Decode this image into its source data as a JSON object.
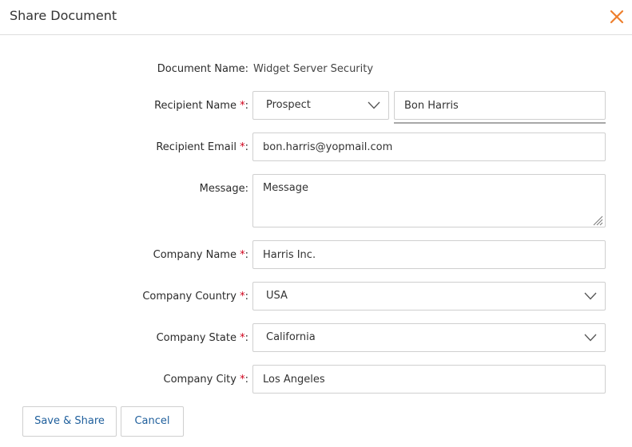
{
  "dialog": {
    "title": "Share Document",
    "close_icon": "close-icon",
    "accent_color": "#ee7f2d"
  },
  "form": {
    "required_marker": "*",
    "document_name": {
      "label": "Document Name:",
      "value": "Widget Server Security"
    },
    "recipient_name": {
      "label": "Recipient Name ",
      "label_suffix": ":",
      "type_selected": "Prospect",
      "value": "Bon Harris"
    },
    "recipient_email": {
      "label": "Recipient Email ",
      "label_suffix": ":",
      "value": "bon.harris@yopmail.com"
    },
    "message": {
      "label": "Message:",
      "placeholder": "Message"
    },
    "company_name": {
      "label": "Company Name ",
      "label_suffix": ":",
      "value": "Harris Inc."
    },
    "company_country": {
      "label": "Company Country ",
      "label_suffix": ":",
      "selected": "USA"
    },
    "company_state": {
      "label": "Company State ",
      "label_suffix": ":",
      "selected": "California"
    },
    "company_city": {
      "label": "Company City ",
      "label_suffix": ":",
      "value": "Los Angeles"
    }
  },
  "footer": {
    "save_label": "Save & Share",
    "cancel_label": "Cancel",
    "button_text_color": "#1f5f9c"
  }
}
